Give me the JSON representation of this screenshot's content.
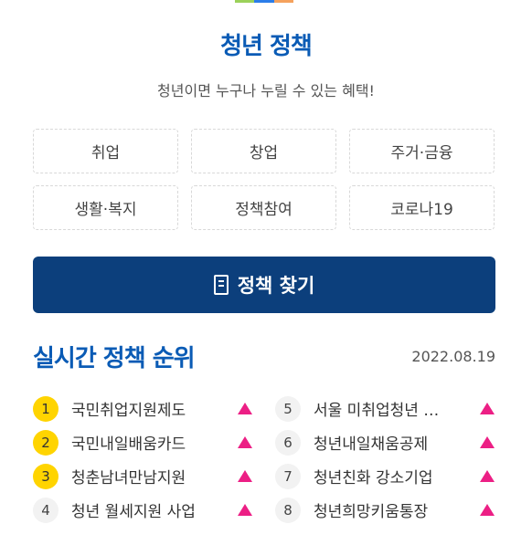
{
  "colors": {
    "accent_blue": "#0a5bb5",
    "button_navy": "#0c3f7c",
    "rank_top": "#ffd400",
    "trend_up": "#ec1f85",
    "top_bar": [
      "#9bd15a",
      "#2b7de9",
      "#f5a25d"
    ]
  },
  "header": {
    "title": "청년 정책",
    "subtitle": "청년이면 누구나 누릴 수 있는 혜택!"
  },
  "categories": [
    "취업",
    "창업",
    "주거·금융",
    "생활·복지",
    "정책참여",
    "코로나19"
  ],
  "search": {
    "label": "정책 찾기",
    "icon": "book-icon"
  },
  "ranking": {
    "title": "실시간 정책 순위",
    "date": "2022.08.19",
    "trend_icon": "trend-up-icon",
    "items": [
      {
        "rank": "1",
        "name": "국민취업지원제도"
      },
      {
        "rank": "2",
        "name": "국민내일배움카드"
      },
      {
        "rank": "3",
        "name": "청춘남녀만남지원"
      },
      {
        "rank": "4",
        "name": "청년 월세지원 사업"
      },
      {
        "rank": "5",
        "name": "서울 미취업청년 …"
      },
      {
        "rank": "6",
        "name": "청년내일채움공제"
      },
      {
        "rank": "7",
        "name": "청년친화 강소기업"
      },
      {
        "rank": "8",
        "name": "청년희망키움통장"
      }
    ]
  }
}
